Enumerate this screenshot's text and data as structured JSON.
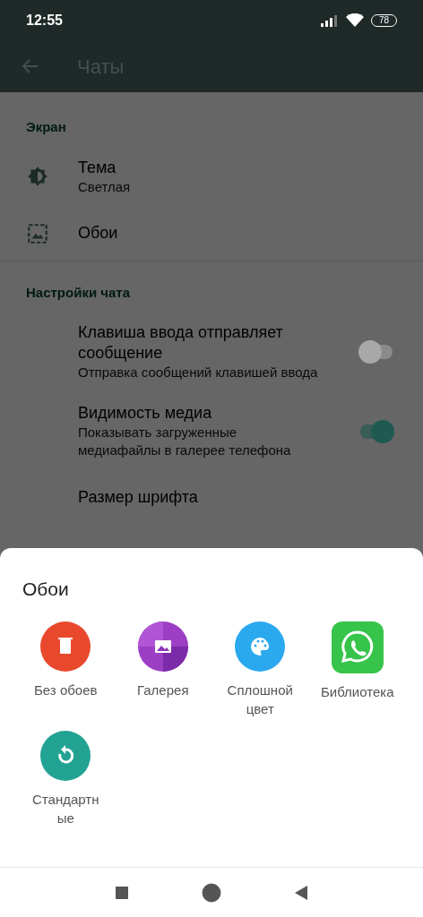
{
  "status_bar": {
    "time": "12:55",
    "battery": "78"
  },
  "toolbar": {
    "title": "Чаты"
  },
  "sections": [
    {
      "heading": "Экран",
      "items": [
        {
          "kind": "theme",
          "title": "Тема",
          "subtitle": "Светлая"
        },
        {
          "kind": "wallpaper",
          "title": "Обои"
        }
      ]
    },
    {
      "heading": "Настройки чата",
      "items": [
        {
          "kind": "switch",
          "title": "Клавиша ввода отправляет сообщение",
          "subtitle": "Отправка сообщений клавишей ввода",
          "on": false
        },
        {
          "kind": "switch",
          "title": "Видимость медиа",
          "subtitle": "Показывать загруженные медиафайлы в галерее телефона",
          "on": true
        },
        {
          "kind": "plain",
          "title": "Размер шрифта"
        }
      ]
    }
  ],
  "sheet": {
    "title": "Обои",
    "options": [
      {
        "kind": "none",
        "label": "Без обоев"
      },
      {
        "kind": "gallery",
        "label": "Галерея"
      },
      {
        "kind": "solid",
        "label": "Сплошной цвет"
      },
      {
        "kind": "library",
        "label": "Библиотека"
      },
      {
        "kind": "default",
        "label": "Стандартные"
      }
    ]
  }
}
